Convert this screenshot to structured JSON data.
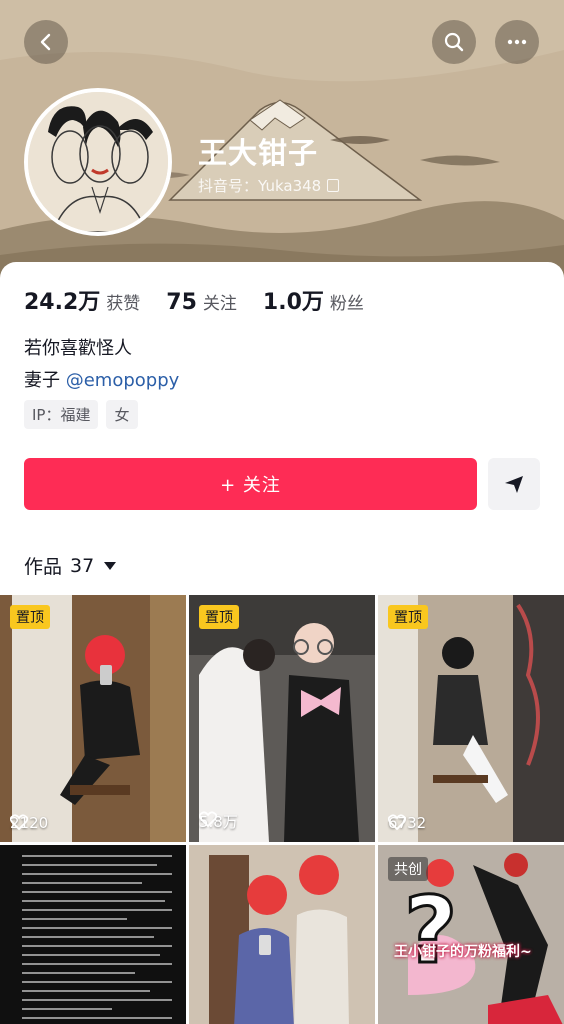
{
  "header": {
    "nickname": "王大钳子",
    "douyin_id": "抖音号：Yuka348",
    "icons": [
      "back-icon",
      "search-icon",
      "more-icon"
    ]
  },
  "stats": [
    {
      "number": "24.2万",
      "label": "获赞"
    },
    {
      "number": "75",
      "label": "关注"
    },
    {
      "number": "1.0万",
      "label": "粉丝"
    }
  ],
  "bio": {
    "line1": "若你喜歡怪人",
    "line2_prefix": "妻子 ",
    "line2_mention": "@emopoppy"
  },
  "tags": [
    "IP：福建",
    "女"
  ],
  "actions": {
    "follow_label": "+ 关注",
    "send_icon": "send-icon"
  },
  "works_tab": {
    "label": "作品",
    "count": "37"
  },
  "colors": {
    "accent": "#fe2c55",
    "pin": "#f9c71f",
    "mention": "#2c5fa8"
  },
  "videos": [
    {
      "badge": "置顶",
      "likes": "2120"
    },
    {
      "badge": "置顶",
      "likes": "5.8万"
    },
    {
      "badge": "置顶",
      "likes": "6732"
    },
    {
      "badge": "",
      "likes": ""
    },
    {
      "badge": "",
      "likes": ""
    },
    {
      "badge": "共创",
      "caption": "王小钳子的万粉福利~",
      "likes": ""
    }
  ]
}
